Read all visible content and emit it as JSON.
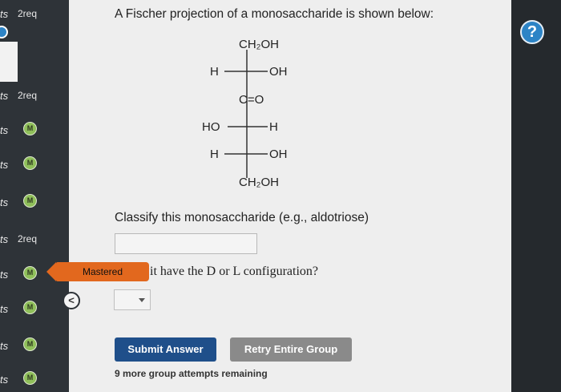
{
  "sidebar": {
    "items": [
      {
        "pts": "ts",
        "req": "2req",
        "badge": ""
      },
      {
        "pts": "ts",
        "req": "2req",
        "badge": ""
      },
      {
        "pts": "ts",
        "req": "",
        "badge": "M"
      },
      {
        "pts": "ts",
        "req": "",
        "badge": "M"
      },
      {
        "pts": "ts",
        "req": "",
        "badge": "M"
      },
      {
        "pts": "ts",
        "req": "2req",
        "badge": ""
      },
      {
        "pts": "ts",
        "req": "",
        "badge": "M"
      },
      {
        "pts": "ts",
        "req": "",
        "badge": "M"
      },
      {
        "pts": "ts",
        "req": "",
        "badge": "M"
      },
      {
        "pts": "ts",
        "req": "",
        "badge": "M"
      }
    ]
  },
  "question": {
    "intro": "A Fischer projection of a monosaccharide is shown below:",
    "structure": {
      "top": "CH₂OH",
      "rows": [
        {
          "left": "H",
          "right": "OH"
        },
        {
          "center": "C=O"
        },
        {
          "left": "HO",
          "right": "H"
        },
        {
          "left": "H",
          "right": "OH"
        }
      ],
      "bottom": "CH₂OH"
    },
    "classify_prompt": "Classify this monosaccharide (e.g., aldotriose)",
    "classify_value": "",
    "config_prompt": "it have the D or L configuration?",
    "config_value": ""
  },
  "mastered_label": "Mastered",
  "help_label": "?",
  "collapse_label": "<",
  "buttons": {
    "submit": "Submit Answer",
    "retry": "Retry Entire Group"
  },
  "attempts_text": "9 more group attempts remaining",
  "colors": {
    "sidebar": "#2e3338",
    "mastered": "#e2681e",
    "submit": "#1f4f8a",
    "retry": "#8a8a8a",
    "help": "#2d84c6",
    "badge": "#8fbf5a"
  }
}
